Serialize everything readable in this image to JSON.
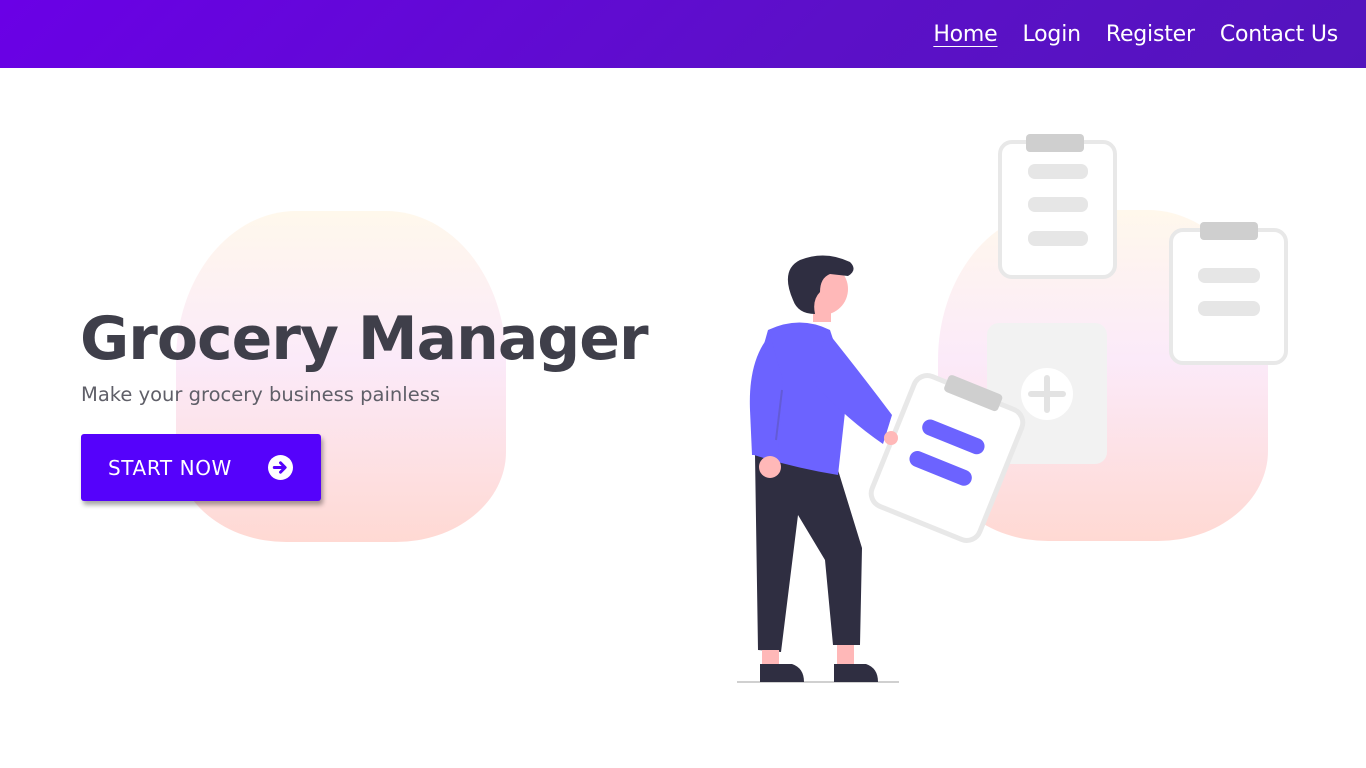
{
  "nav": {
    "items": [
      {
        "label": "Home",
        "active": true
      },
      {
        "label": "Login",
        "active": false
      },
      {
        "label": "Register",
        "active": false
      },
      {
        "label": "Contact Us",
        "active": false
      }
    ]
  },
  "hero": {
    "title": "Grocery Manager",
    "subtitle": "Make your grocery business painless",
    "cta_label": "START NOW",
    "cta_icon": "arrow-right-circle-icon"
  },
  "colors": {
    "nav_gradient_start": "#6a00e6",
    "nav_gradient_end": "#5314bd",
    "accent": "#5502fb",
    "illustration_primary": "#6c63ff",
    "title_text": "#3f3f4a"
  },
  "illustration": {
    "name": "person-with-clipboards-illustration"
  }
}
